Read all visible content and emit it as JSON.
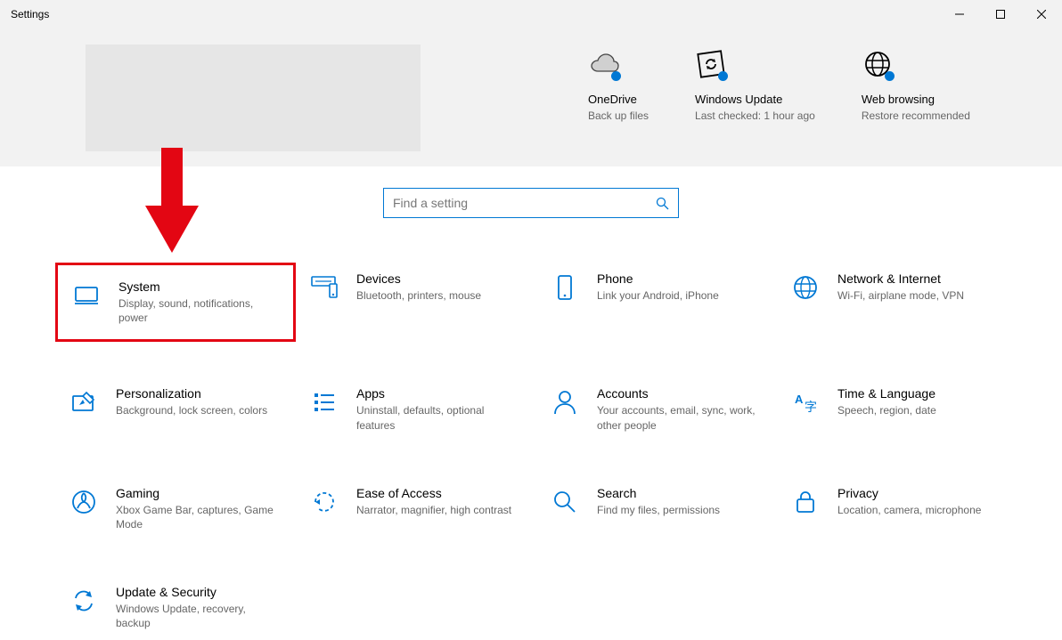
{
  "window": {
    "title": "Settings"
  },
  "status": [
    {
      "id": "onedrive",
      "title": "OneDrive",
      "sub": "Back up files"
    },
    {
      "id": "windows-update",
      "title": "Windows Update",
      "sub": "Last checked: 1 hour ago"
    },
    {
      "id": "web-browsing",
      "title": "Web browsing",
      "sub": "Restore recommended"
    }
  ],
  "search": {
    "placeholder": "Find a setting"
  },
  "categories": {
    "system": {
      "title": "System",
      "sub": "Display, sound, notifications, power"
    },
    "devices": {
      "title": "Devices",
      "sub": "Bluetooth, printers, mouse"
    },
    "phone": {
      "title": "Phone",
      "sub": "Link your Android, iPhone"
    },
    "network": {
      "title": "Network & Internet",
      "sub": "Wi-Fi, airplane mode, VPN"
    },
    "personalization": {
      "title": "Personalization",
      "sub": "Background, lock screen, colors"
    },
    "apps": {
      "title": "Apps",
      "sub": "Uninstall, defaults, optional features"
    },
    "accounts": {
      "title": "Accounts",
      "sub": "Your accounts, email, sync, work, other people"
    },
    "time": {
      "title": "Time & Language",
      "sub": "Speech, region, date"
    },
    "gaming": {
      "title": "Gaming",
      "sub": "Xbox Game Bar, captures, Game Mode"
    },
    "ease": {
      "title": "Ease of Access",
      "sub": "Narrator, magnifier, high contrast"
    },
    "search_cat": {
      "title": "Search",
      "sub": "Find my files, permissions"
    },
    "privacy": {
      "title": "Privacy",
      "sub": "Location, camera, microphone"
    },
    "update": {
      "title": "Update & Security",
      "sub": "Windows Update, recovery, backup"
    }
  }
}
